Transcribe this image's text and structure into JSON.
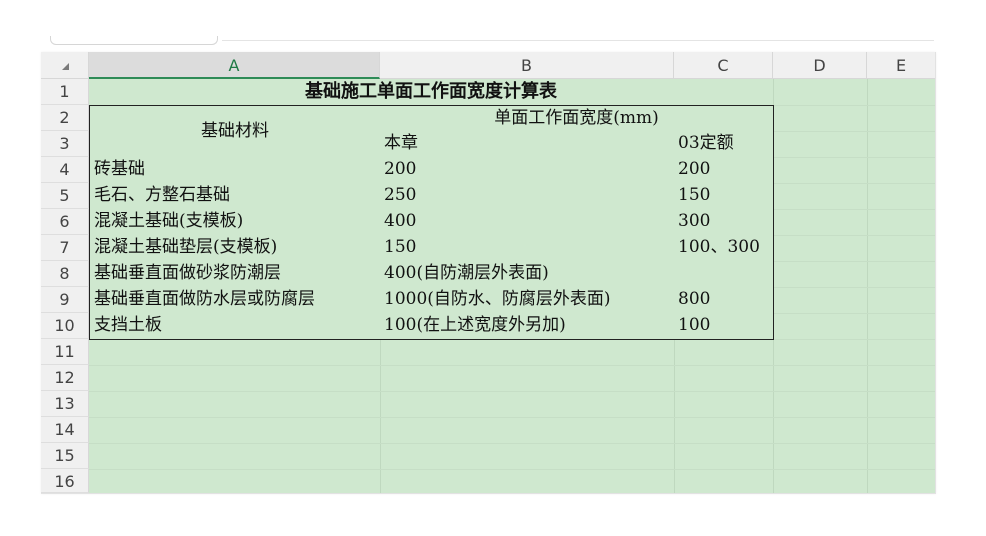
{
  "columns": [
    "A",
    "B",
    "C",
    "D",
    "E"
  ],
  "rows": [
    "1",
    "2",
    "3",
    "4",
    "5",
    "6",
    "7",
    "8",
    "9",
    "10",
    "11",
    "12",
    "13",
    "14",
    "15",
    "16"
  ],
  "colors": {
    "cell_background": "#cfe8cf",
    "header_background": "#f0f0f0",
    "active_column_text": "#1f7a44"
  },
  "sheet": {
    "title": "基础施工单面工作面宽度计算表",
    "header_material": "基础材料",
    "header_width": "单面工作面宽度(mm)",
    "header_sub_b": "本章",
    "header_sub_c": "03定额",
    "body": [
      {
        "a": "砖基础",
        "b": "200",
        "c": "200"
      },
      {
        "a": "毛石、方整石基础",
        "b": "250",
        "c": "150"
      },
      {
        "a": "混凝土基础(支模板)",
        "b": "400",
        "c": "300"
      },
      {
        "a": "混凝土基础垫层(支模板)",
        "b": "150",
        "c": "100、300"
      },
      {
        "a": "基础垂直面做砂浆防潮层",
        "b": "400(自防潮层外表面)",
        "c": ""
      },
      {
        "a": "基础垂直面做防水层或防腐层",
        "b": "1000(自防水、防腐层外表面)",
        "c": "800"
      },
      {
        "a": "支挡土板",
        "b": "100(在上述宽度外另加)",
        "c": "100"
      }
    ]
  }
}
